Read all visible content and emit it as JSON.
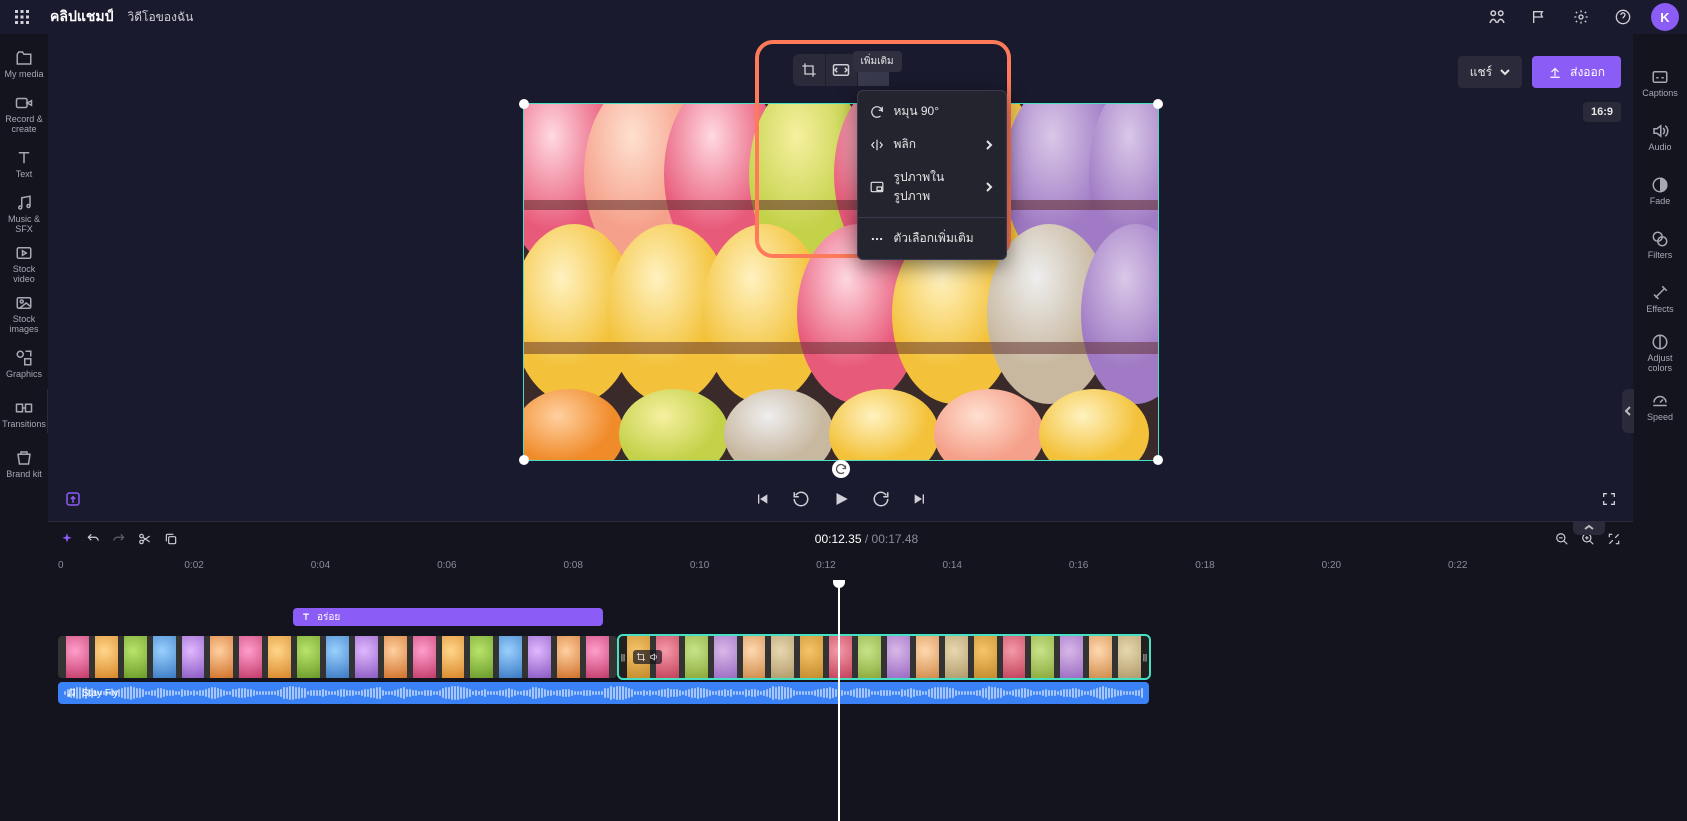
{
  "header": {
    "app_name": "คลิปแชมป์",
    "project_name": "วิดีโอของฉัน",
    "avatar_initial": "K"
  },
  "actions": {
    "share_label": "แชร์",
    "export_label": "ส่งออก",
    "aspect_ratio": "16:9"
  },
  "tooltip": {
    "more": "เพิ่มเติม"
  },
  "context_menu": {
    "rotate": "หมุน 90°",
    "flip": "พลิก",
    "pip": "รูปภาพในรูปภาพ",
    "more_options": "ตัวเลือกเพิ่มเติม"
  },
  "left_sidebar": [
    {
      "id": "my-media",
      "label": "My media"
    },
    {
      "id": "record-create",
      "label": "Record & create"
    },
    {
      "id": "text",
      "label": "Text"
    },
    {
      "id": "music-sfx",
      "label": "Music & SFX"
    },
    {
      "id": "stock-video",
      "label": "Stock video"
    },
    {
      "id": "stock-images",
      "label": "Stock images"
    },
    {
      "id": "graphics",
      "label": "Graphics"
    },
    {
      "id": "transitions",
      "label": "Transitions"
    },
    {
      "id": "brand-kit",
      "label": "Brand kit"
    }
  ],
  "right_sidebar": [
    {
      "id": "captions",
      "label": "Captions"
    },
    {
      "id": "audio",
      "label": "Audio"
    },
    {
      "id": "fade",
      "label": "Fade"
    },
    {
      "id": "filters",
      "label": "Filters"
    },
    {
      "id": "effects",
      "label": "Effects"
    },
    {
      "id": "adjust-colors",
      "label": "Adjust colors"
    },
    {
      "id": "speed",
      "label": "Speed"
    }
  ],
  "transport": {
    "timecode_current": "00:12.35",
    "timecode_total": "00:17.48"
  },
  "ruler_ticks": [
    "0",
    "0:02",
    "0:04",
    "0:06",
    "0:08",
    "0:10",
    "0:12",
    "0:14",
    "0:16",
    "0:18",
    "0:20",
    "0:22"
  ],
  "timeline": {
    "text_clip": {
      "label": "อร่อย"
    },
    "audio_clip": {
      "label": "Stay Fly"
    }
  }
}
